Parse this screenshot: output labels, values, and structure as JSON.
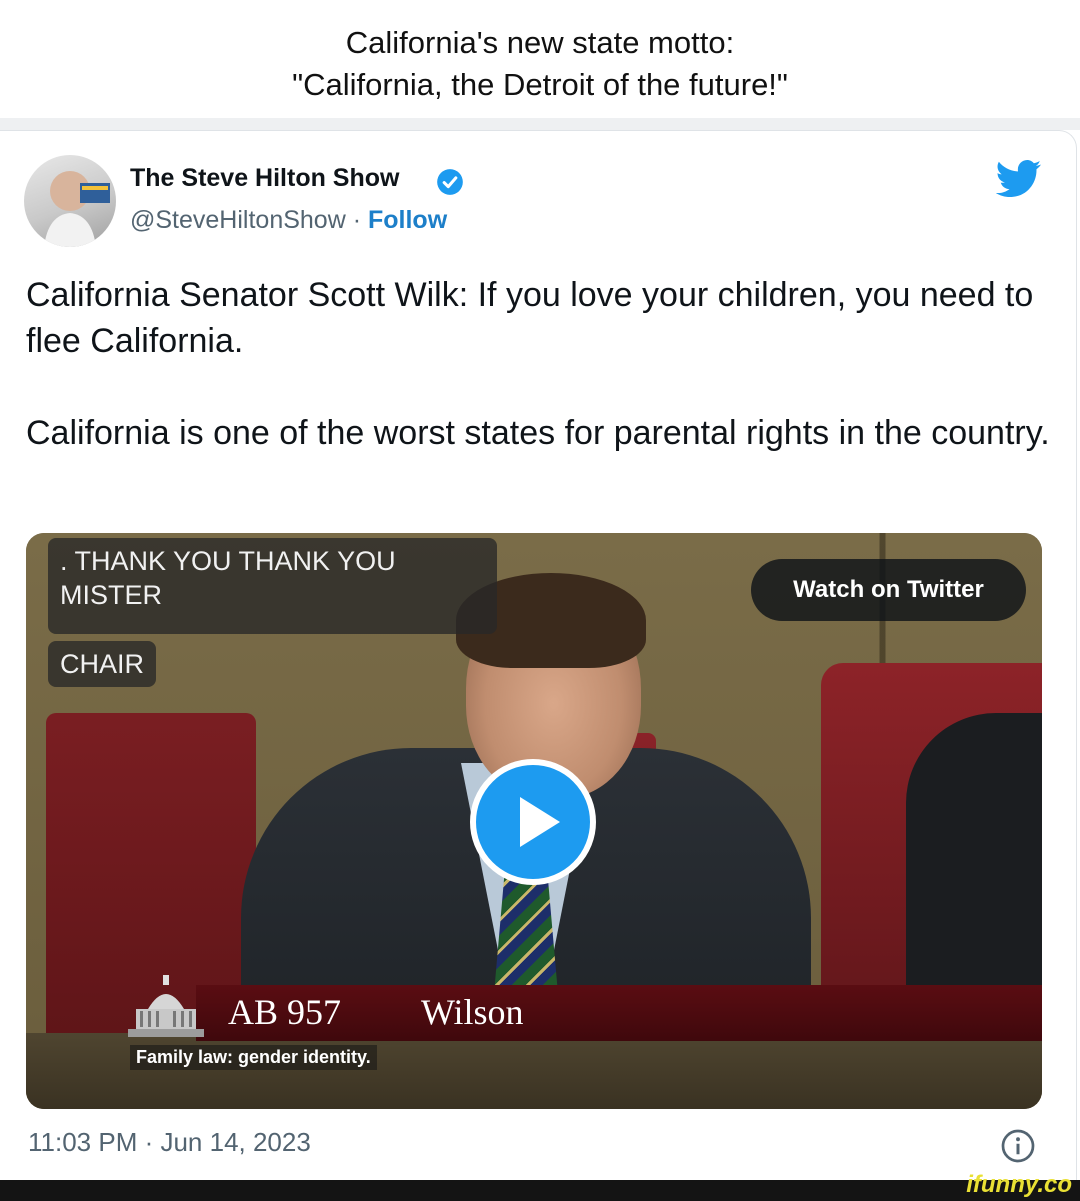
{
  "caption": {
    "line1": "California's new state motto:",
    "line2": "\"California, the Detroit of the future!\""
  },
  "tweet": {
    "author_name": "The Steve Hilton Show",
    "handle": "@SteveHiltonShow",
    "separator": " · ",
    "follow_label": "Follow",
    "paragraph1": "California Senator Scott Wilk: If you love your children, you need to flee California.",
    "paragraph2": "California is one of the worst states for parental rights in the country.",
    "timestamp": "11:03 PM · Jun 14, 2023",
    "verified_color": "#1d9bf0",
    "twitter_brand_color": "#1d9bf0"
  },
  "video": {
    "watch_label": "Watch on Twitter",
    "caption_line1": ". THANK YOU THANK YOU MISTER",
    "caption_line2": "CHAIR",
    "bill_number": "AB 957",
    "member_name": "Wilson",
    "subject": "Family law: gender identity."
  },
  "watermark": "ifunny.co"
}
